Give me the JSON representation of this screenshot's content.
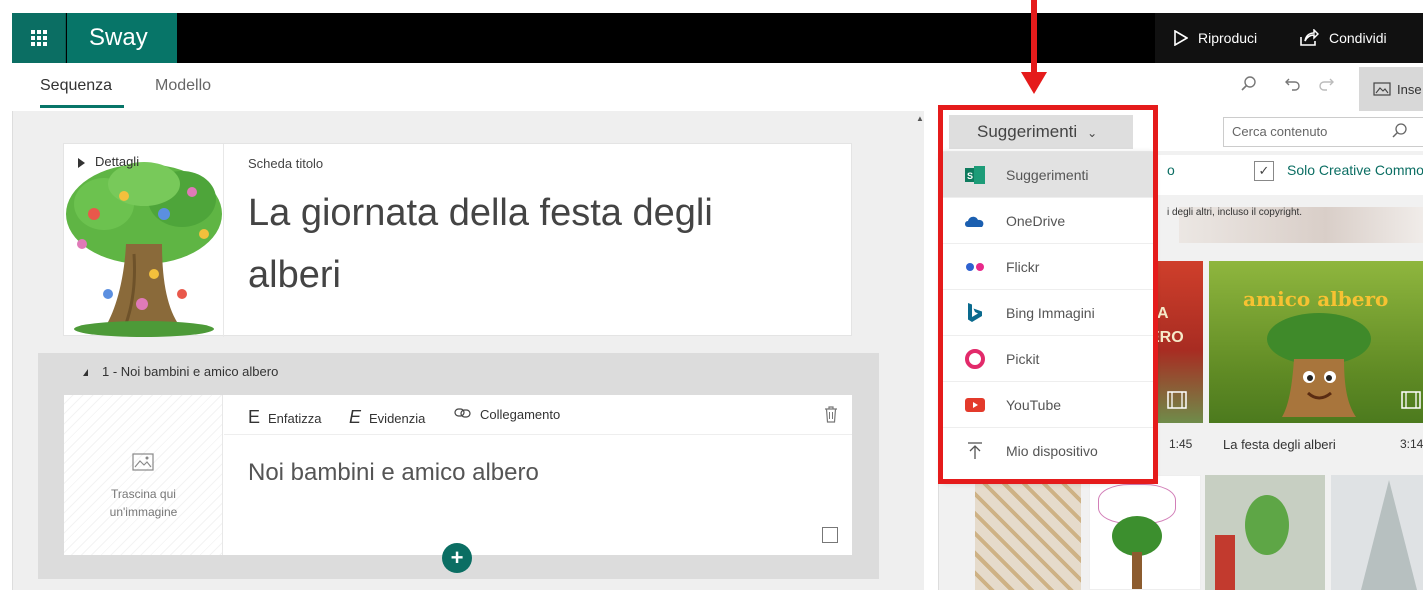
{
  "app": {
    "name": "Sway",
    "brand_color": "#077568"
  },
  "topbar": {
    "play_label": "Riproduci",
    "share_label": "Condividi"
  },
  "tabs": [
    {
      "label": "Sequenza",
      "active": true
    },
    {
      "label": "Modello",
      "active": false
    }
  ],
  "toolbar": {
    "insert_label": "Inse"
  },
  "title_card": {
    "details_label": "Dettagli",
    "card_label": "Scheda titolo",
    "title": "La giornata della festa degli alberi"
  },
  "section": {
    "heading": "1 - Noi bambini e amico albero",
    "drop_hint_1": "Trascina qui",
    "drop_hint_2": "un'immagine",
    "format": {
      "emphasize": "Enfatizza",
      "highlight": "Evidenzia",
      "link": "Collegamento"
    },
    "body_text": "Noi bambini e amico albero"
  },
  "right_panel": {
    "source_button": "Suggerimenti",
    "search_placeholder": "Cerca contenuto",
    "cc_fragment": "o",
    "cc_label": "Solo Creative Common",
    "copyright_note": "i degli altri, incluso il copyright.",
    "tiles": [
      {
        "caption": "",
        "time": "1:45"
      },
      {
        "caption": "La festa degli alberi",
        "time": "3:14"
      }
    ],
    "book_title": "amico albero",
    "partial_book_text_1": "A",
    "partial_book_text_2": "ERO"
  },
  "menu": {
    "items": [
      {
        "label": "Suggerimenti",
        "icon": "suggestions-icon",
        "selected": true
      },
      {
        "label": "OneDrive",
        "icon": "onedrive-icon",
        "selected": false
      },
      {
        "label": "Flickr",
        "icon": "flickr-icon",
        "selected": false
      },
      {
        "label": "Bing Immagini",
        "icon": "bing-icon",
        "selected": false
      },
      {
        "label": "Pickit",
        "icon": "pickit-icon",
        "selected": false
      },
      {
        "label": "YouTube",
        "icon": "youtube-icon",
        "selected": false
      },
      {
        "label": "Mio dispositivo",
        "icon": "upload-icon",
        "selected": false
      }
    ]
  },
  "annotation": {
    "color": "#e51b1b"
  }
}
